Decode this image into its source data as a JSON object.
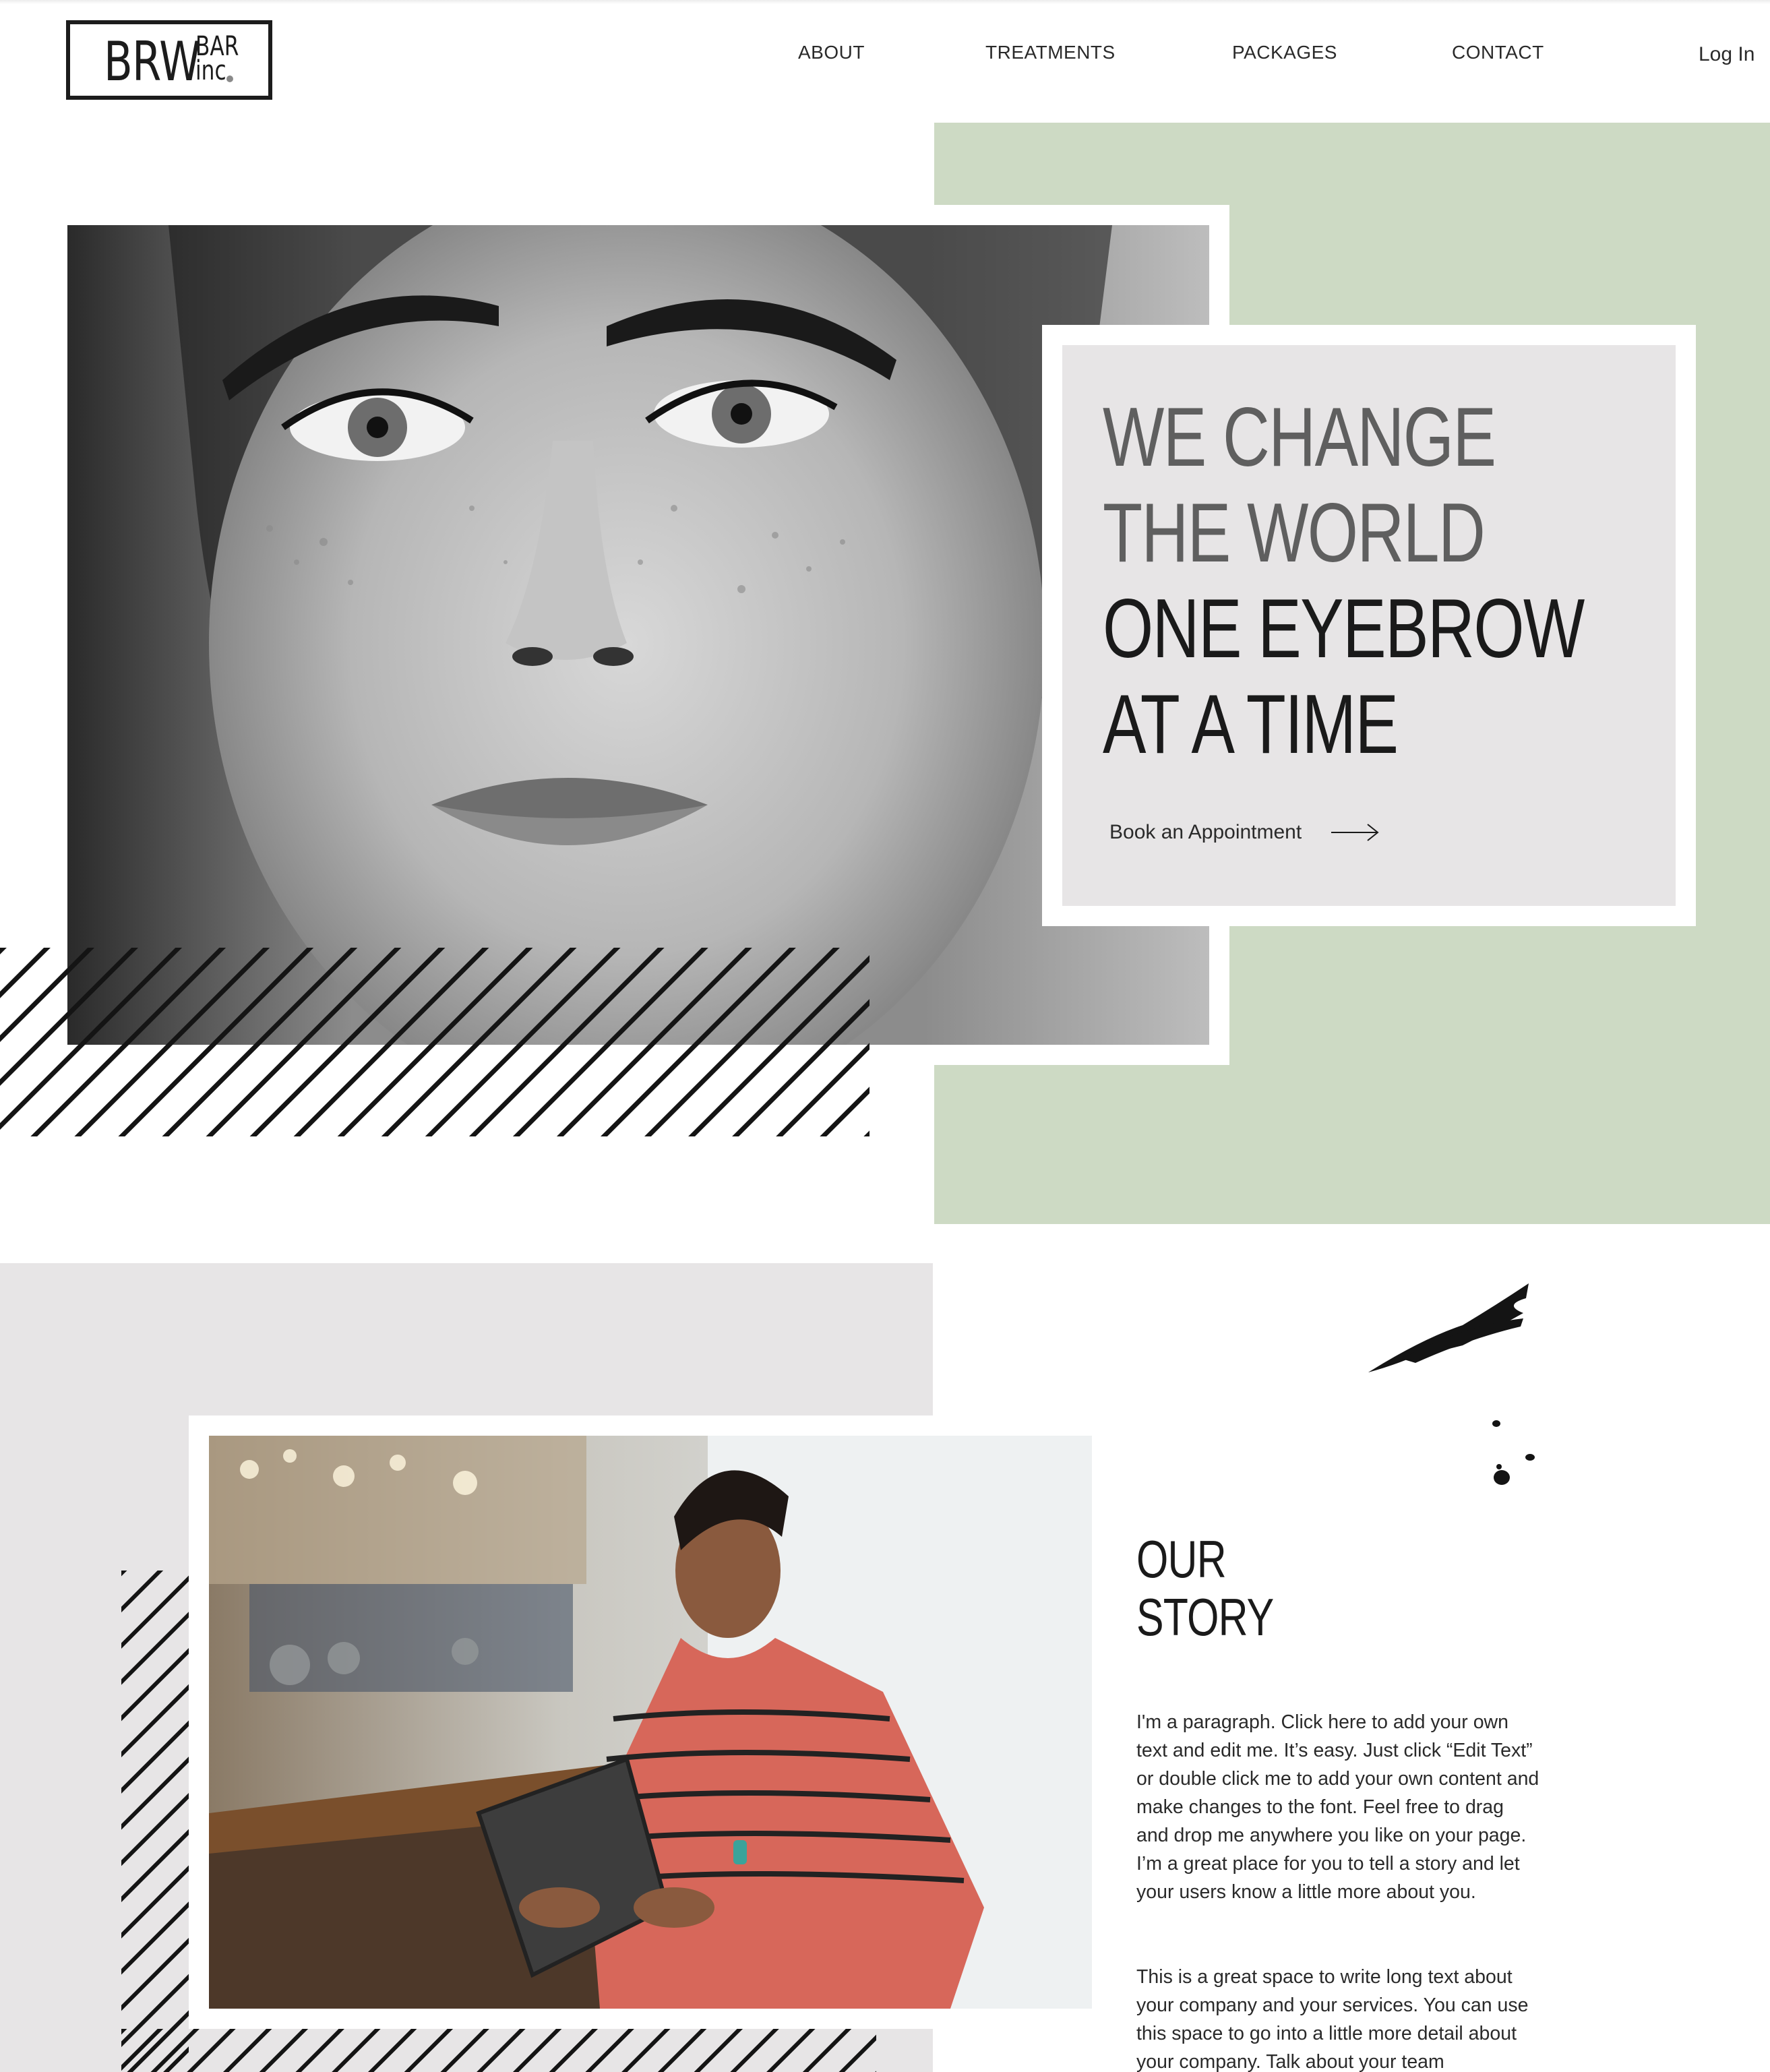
{
  "brand": {
    "logo_main": "BRW",
    "logo_top": "BAR",
    "logo_bottom": "inc"
  },
  "nav": {
    "items": [
      {
        "label": "ABOUT"
      },
      {
        "label": "TREATMENTS"
      },
      {
        "label": "PACKAGES"
      },
      {
        "label": "CONTACT"
      }
    ],
    "login": "Log In"
  },
  "hero": {
    "headline": [
      "WE CHANGE",
      "THE WORLD",
      "ONE EYEBROW",
      "AT A TIME"
    ],
    "cta_label": "Book an Appointment",
    "cta_icon": "arrow-right-icon",
    "accent_color": "#cddac4",
    "card_color": "#e7e5e6"
  },
  "story": {
    "title": [
      "OUR",
      "STORY"
    ],
    "paragraphs": [
      "I'm a paragraph. Click here to add your own text and edit me. It’s easy. Just click “Edit Text” or double click me to add your own content and make changes to the font. Feel free to drag and drop me anywhere you like on your page. I’m a great place for you to tell a story and let your users know a little more about you.",
      "This is a great space to write long text about your company and your services. You can use this space to go into a little more detail about your company. Talk about your team"
    ]
  }
}
